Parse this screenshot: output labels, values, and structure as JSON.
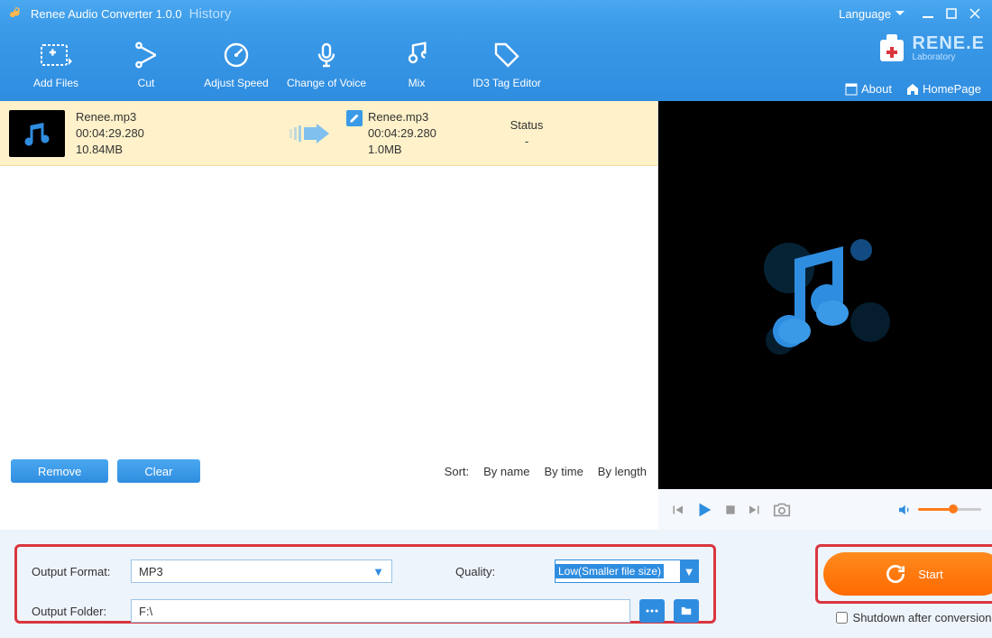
{
  "titlebar": {
    "title": "Renee Audio Converter 1.0.0",
    "history": "History",
    "language": "Language"
  },
  "toolbar": {
    "items": [
      {
        "label": "Add Files"
      },
      {
        "label": "Cut"
      },
      {
        "label": "Adjust Speed"
      },
      {
        "label": "Change of Voice"
      },
      {
        "label": "Mix"
      },
      {
        "label": "ID3 Tag Editor"
      }
    ],
    "brand": "RENE.E",
    "brand_sub": "Laboratory",
    "about": "About",
    "homepage": "HomePage"
  },
  "file": {
    "src": {
      "name": "Renee.mp3",
      "duration": "00:04:29.280",
      "size": "10.84MB"
    },
    "out": {
      "name": "Renee.mp3",
      "duration": "00:04:29.280",
      "size": "1.0MB"
    },
    "status_label": "Status",
    "status_value": "-"
  },
  "buttons": {
    "remove": "Remove",
    "clear": "Clear"
  },
  "sort": {
    "label": "Sort:",
    "by_name": "By name",
    "by_time": "By time",
    "by_length": "By length"
  },
  "output": {
    "format_label": "Output Format:",
    "format_value": "MP3",
    "quality_label": "Quality:",
    "quality_value": "Low(Smaller file size)",
    "folder_label": "Output Folder:",
    "folder_value": "F:\\"
  },
  "start": {
    "label": "Start",
    "shutdown": "Shutdown after conversion"
  }
}
